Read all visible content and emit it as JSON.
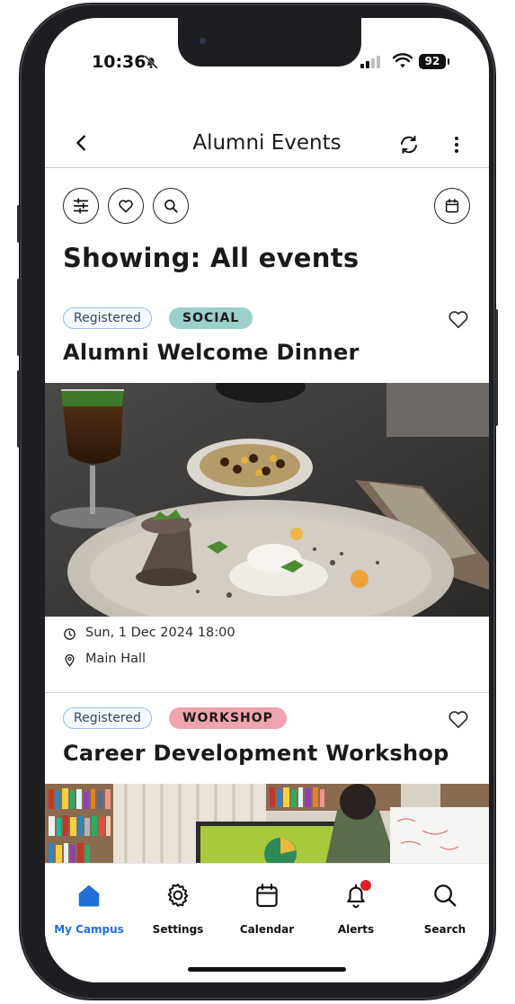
{
  "status_bar": {
    "time": "10:36",
    "battery": "92"
  },
  "header": {
    "title": "Alumni Events"
  },
  "filter": {
    "heading": "Showing: All events"
  },
  "events": [
    {
      "registered_label": "Registered",
      "category": "SOCIAL",
      "category_color": "#9bcfc9",
      "title": "Alumni Welcome Dinner",
      "datetime": "Sun, 1 Dec 2024 18:00",
      "location": "Main Hall"
    },
    {
      "registered_label": "Registered",
      "category": "WORKSHOP",
      "category_color": "#f0a3ad",
      "title": "Career Development Workshop"
    }
  ],
  "nav": {
    "items": [
      {
        "label": "My Campus",
        "icon": "home-icon",
        "active": true
      },
      {
        "label": "Settings",
        "icon": "gear-icon"
      },
      {
        "label": "Calendar",
        "icon": "calendar-icon"
      },
      {
        "label": "Alerts",
        "icon": "bell-icon"
      },
      {
        "label": "Search",
        "icon": "search-icon"
      }
    ]
  },
  "colors": {
    "accent": "#1f6fd6",
    "alert_dot": "#e0202c"
  }
}
